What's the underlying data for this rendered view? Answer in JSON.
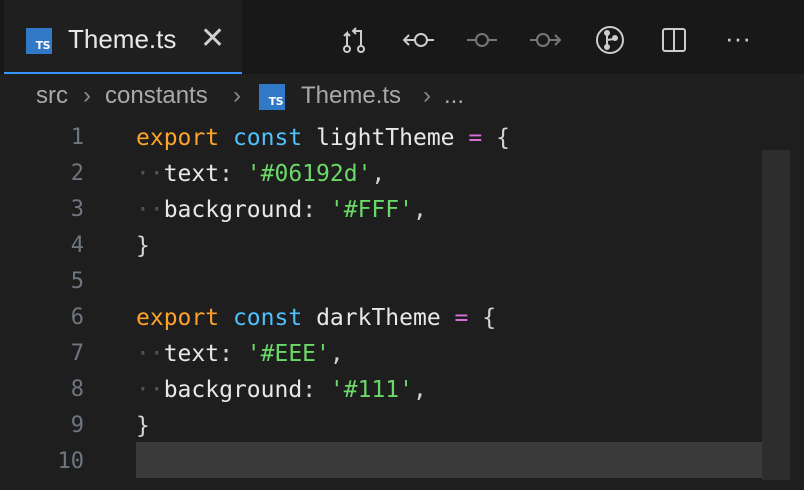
{
  "tab": {
    "badge": "TS",
    "title": "Theme.ts",
    "close": "✕"
  },
  "breadcrumb": {
    "items": [
      "src",
      "constants",
      "Theme.ts",
      "..."
    ],
    "sep": "›",
    "badge": "TS"
  },
  "toolbar": {
    "icons": [
      "compare-changes-icon",
      "go-back-icon",
      "commit-icon",
      "go-forward-icon",
      "git-graph-icon",
      "split-editor-icon",
      "more-actions-icon"
    ],
    "more": "···"
  },
  "editor": {
    "line_numbers": [
      "1",
      "2",
      "3",
      "4",
      "5",
      "6",
      "7",
      "8",
      "9",
      "10"
    ],
    "lines": [
      [
        [
          "kw-export",
          "export"
        ],
        [
          "punc",
          " "
        ],
        [
          "kw-const",
          "const"
        ],
        [
          "punc",
          " "
        ],
        [
          "ident",
          "lightTheme"
        ],
        [
          "punc",
          " "
        ],
        [
          "op",
          "="
        ],
        [
          "punc",
          " {"
        ]
      ],
      [
        [
          "dots",
          "··"
        ],
        [
          "ident",
          "text"
        ],
        [
          "punc",
          ": "
        ],
        [
          "str",
          "'#06192d'"
        ],
        [
          "punc",
          ","
        ]
      ],
      [
        [
          "dots",
          "··"
        ],
        [
          "ident",
          "background"
        ],
        [
          "punc",
          ": "
        ],
        [
          "str",
          "'#FFF'"
        ],
        [
          "punc",
          ","
        ]
      ],
      [
        [
          "punc",
          "}"
        ]
      ],
      [],
      [
        [
          "kw-export",
          "export"
        ],
        [
          "punc",
          " "
        ],
        [
          "kw-const",
          "const"
        ],
        [
          "punc",
          " "
        ],
        [
          "ident",
          "darkTheme"
        ],
        [
          "punc",
          " "
        ],
        [
          "op",
          "="
        ],
        [
          "punc",
          " {"
        ]
      ],
      [
        [
          "dots",
          "··"
        ],
        [
          "ident",
          "text"
        ],
        [
          "punc",
          ": "
        ],
        [
          "str",
          "'#EEE'"
        ],
        [
          "punc",
          ","
        ]
      ],
      [
        [
          "dots",
          "··"
        ],
        [
          "ident",
          "background"
        ],
        [
          "punc",
          ": "
        ],
        [
          "str",
          "'#111'"
        ],
        [
          "punc",
          ","
        ]
      ],
      [
        [
          "punc",
          "}"
        ]
      ],
      []
    ]
  },
  "colors": {
    "accent": "#3794ff",
    "ts_badge": "#3178c6"
  }
}
